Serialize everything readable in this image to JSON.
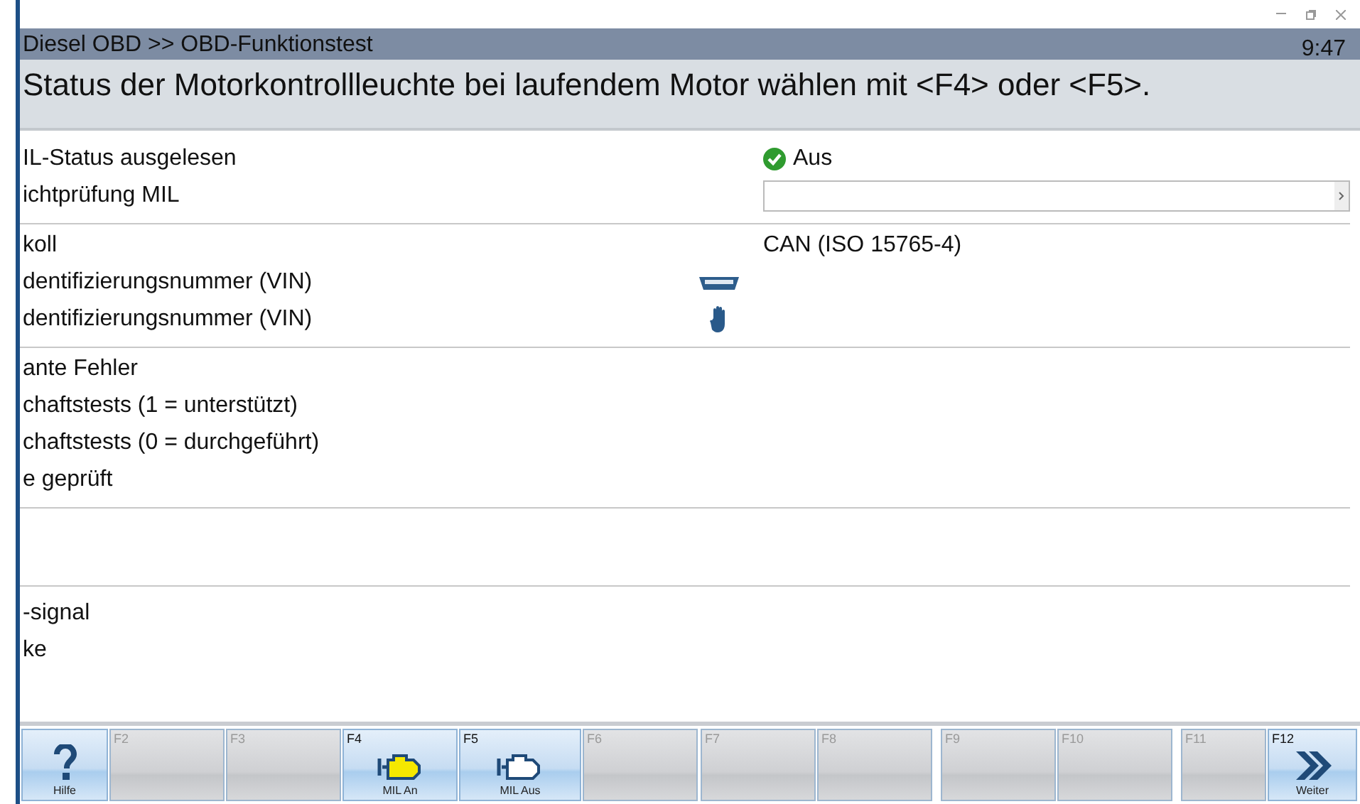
{
  "header": {
    "title": "Diesel OBD >> OBD-Funktionstest",
    "time": "9:47"
  },
  "instruction": "Status der Motorkontrollleuchte bei laufendem Motor wählen mit <F4> oder <F5>.",
  "sections": [
    {
      "rows": [
        {
          "label": "IL-Status ausgelesen",
          "kind": "check",
          "value": "Aus"
        },
        {
          "label": "ichtprüfung MIL",
          "kind": "field"
        }
      ]
    },
    {
      "rows": [
        {
          "label": "koll",
          "kind": "text",
          "value": "CAN (ISO 15765-4)"
        },
        {
          "label": "dentifizierungsnummer (VIN)",
          "kind": "connector"
        },
        {
          "label": "dentifizierungsnummer (VIN)",
          "kind": "hand"
        }
      ]
    },
    {
      "rows": [
        {
          "label": "ante Fehler",
          "kind": "text"
        },
        {
          "label": "chaftstests (1 = unterstützt)",
          "kind": "text"
        },
        {
          "label": "chaftstests (0 = durchgeführt)",
          "kind": "text"
        },
        {
          "label": "e geprüft",
          "kind": "text"
        }
      ]
    },
    {
      "kind": "spacer"
    },
    {
      "rows": [
        {
          "label": "-signal",
          "kind": "text"
        },
        {
          "label": "ke",
          "kind": "text"
        }
      ]
    }
  ],
  "function_keys": [
    {
      "label": "Hilfe",
      "kind": "help",
      "enabled": true
    },
    {
      "key": "F2",
      "enabled": false
    },
    {
      "key": "F3",
      "enabled": false
    },
    {
      "key": "F4",
      "label": "MIL An",
      "kind": "engine",
      "lit": true,
      "enabled": true
    },
    {
      "key": "F5",
      "label": "MIL Aus",
      "kind": "engine",
      "lit": false,
      "enabled": true
    },
    {
      "key": "F6",
      "enabled": false
    },
    {
      "key": "F7",
      "enabled": false
    },
    {
      "key": "F8",
      "enabled": false
    },
    {
      "key": "F9",
      "enabled": false
    },
    {
      "key": "F10",
      "enabled": false
    },
    {
      "key": "F11",
      "enabled": false
    },
    {
      "key": "F12",
      "label": "Weiter",
      "kind": "next",
      "enabled": true
    }
  ]
}
